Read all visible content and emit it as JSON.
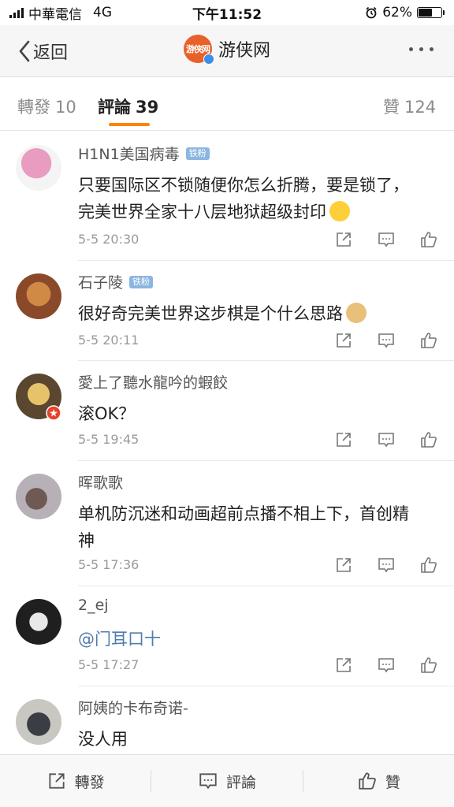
{
  "status_bar": {
    "carrier": "中華電信",
    "network": "4G",
    "time": "下午11:52",
    "battery_percent": "62%",
    "battery_level": 0.62
  },
  "nav": {
    "back_label": "返回",
    "title": "游侠网",
    "avatar_text": "游侠网"
  },
  "tabs": {
    "repost_label": "轉發",
    "repost_count": "10",
    "comment_label": "評論",
    "comment_count": "39",
    "like_label": "贊",
    "like_count": "124"
  },
  "comments": [
    {
      "user": "H1N1美国病毒",
      "badge": "铁粉",
      "text": "只要国际区不锁随便你怎么折腾，要是锁了，完美世界全家十八层地狱超级封印",
      "time": "5-5 20:30",
      "avatar_color": "#c9a3b9"
    },
    {
      "user": "石子陵",
      "badge": "铁粉",
      "text": "很好奇完美世界这步棋是个什么思路",
      "time": "5-5 20:11",
      "avatar_color": "#8a4a2a"
    },
    {
      "user": "愛上了聽水龍吟的蝦餃",
      "badge": "",
      "text": "滚OK？",
      "time": "5-5 19:45",
      "avatar_color": "#5b4630"
    },
    {
      "user": "晖歌歌",
      "badge": "",
      "text": "单机防沉迷和动画超前点播不相上下，首创精神",
      "time": "5-5 17:36",
      "avatar_color": "#9a8f93"
    },
    {
      "user": "2_ej",
      "badge": "",
      "text": "@门耳口十",
      "time": "5-5 17:27",
      "avatar_color": "#1f1f1f"
    },
    {
      "user": "阿姨的卡布奇诺-",
      "badge": "",
      "text": "没人用",
      "time": "",
      "avatar_color": "#6b6d72"
    }
  ],
  "bottom_bar": {
    "repost": "轉發",
    "comment": "評論",
    "like": "贊"
  },
  "colors": {
    "accent": "#ff8200",
    "mention": "#507daf",
    "badge": "#8bb6e0"
  }
}
